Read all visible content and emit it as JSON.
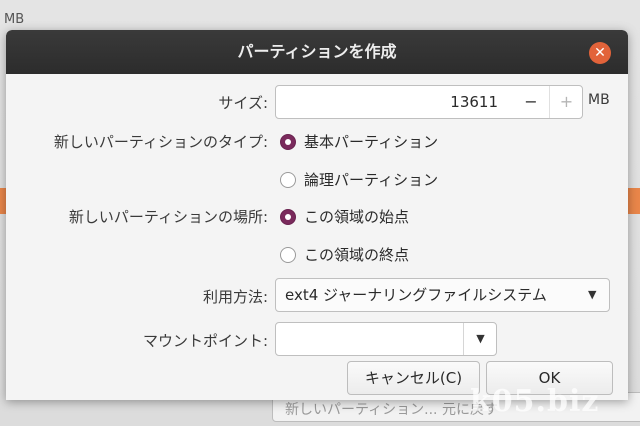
{
  "background": {
    "unit_label": "MB",
    "bottom_button_label": "新しいパーティション... 元に戻す",
    "watermark": "k05.biz"
  },
  "dialog": {
    "title": "パーティションを作成",
    "close_icon": "close-icon"
  },
  "size": {
    "label": "サイズ:",
    "value": "13611",
    "minus": "−",
    "plus": "+",
    "unit": "MB"
  },
  "partition_type": {
    "label": "新しいパーティションのタイプ:",
    "options": [
      "基本パーティション",
      "論理パーティション"
    ],
    "selected": 0
  },
  "location": {
    "label": "新しいパーティションの場所:",
    "options": [
      "この領域の始点",
      "この領域の終点"
    ],
    "selected": 0
  },
  "usage": {
    "label": "利用方法:",
    "value": "ext4 ジャーナリングファイルシステム",
    "arrow_icon": "dropdown-arrow-icon"
  },
  "mount_point": {
    "label": "マウントポイント:",
    "value": "",
    "arrow_icon": "dropdown-arrow-icon"
  },
  "buttons": {
    "cancel": "キャンセル(C)",
    "ok": "OK"
  },
  "colors": {
    "accent_radio": "#7a2a5c",
    "close_button": "#e2633a",
    "titlebar": "#2c2c2c",
    "highlight": "#e9864a"
  }
}
